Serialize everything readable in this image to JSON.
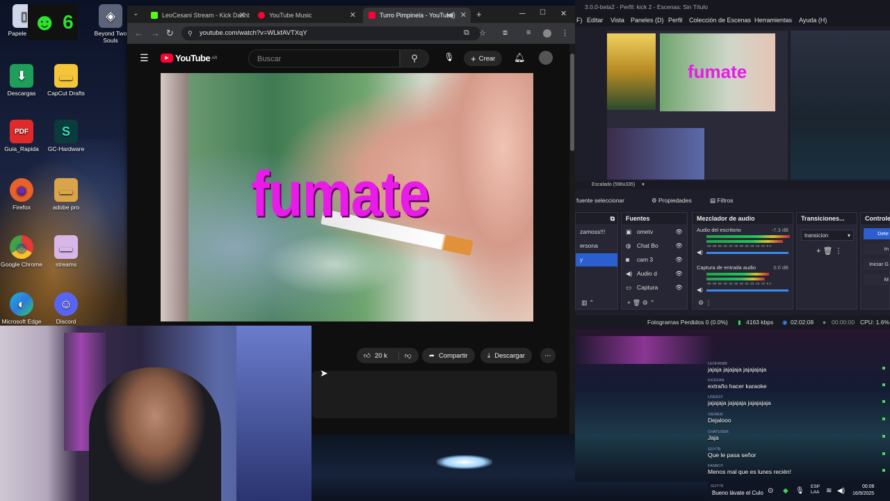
{
  "desktop": {
    "icons": [
      {
        "label": "Papele recic",
        "glyph": "▯"
      },
      {
        "label": "Beyond Two Souls",
        "glyph": "◈"
      },
      {
        "label": "Descargas",
        "glyph": "⬇"
      },
      {
        "label": "CapCut Drafts",
        "glyph": "▬"
      },
      {
        "label": "Guia_Rapida",
        "glyph": "PDF"
      },
      {
        "label": "GC-Hardware",
        "glyph": "S"
      },
      {
        "label": "Firefox",
        "glyph": "◉"
      },
      {
        "label": "adobe pro",
        "glyph": "▬"
      },
      {
        "label": "Google Chrome",
        "glyph": "◎"
      },
      {
        "label": "streams",
        "glyph": "▬"
      },
      {
        "label": "Microsoft Edge",
        "glyph": "◐"
      },
      {
        "label": "Discord",
        "glyph": "☺"
      }
    ],
    "overlay_count": "6"
  },
  "browser": {
    "tabs": [
      {
        "title": "LeoCesani Stream - Kick Dashb",
        "color": "#53fc18"
      },
      {
        "title": "YouTube Music",
        "color": "#ff0033"
      },
      {
        "title": "Turro Pimpinela - YouTube",
        "color": "#ff0033"
      }
    ],
    "url": "youtube.com/watch?v=WLkfAVTXqY",
    "youtube": {
      "logo": "YouTube",
      "region": "AR",
      "search_placeholder": "Buscar",
      "create_label": "Crear",
      "video_caption": "fumate",
      "likes": "20 k",
      "share_label": "Compartir",
      "download_label": "Descargar"
    }
  },
  "obs": {
    "title": "3.0.0-beta2 - Perfil: kick 2 - Escenas: Sin Título",
    "menu": [
      "Editar",
      "Vista",
      "Paneles (D)",
      "Perfil",
      "Colección de Escenas",
      "Herramientas",
      "Ayuda (H)"
    ],
    "scale_label": "Escalado (596x335)",
    "source_name": "fuente seleccionar",
    "properties_label": "Propiedades",
    "filters_label": "Filtros",
    "scenes": [
      "zamoss!!!",
      "ersona",
      "y"
    ],
    "sources_title": "Fuentes",
    "sources": [
      "ometv",
      "Chat Bo",
      "cam 3",
      "Audio d",
      "Captura"
    ],
    "mixer_title": "Mezclador de audio",
    "mixer": [
      {
        "name": "Audio del escritorio",
        "db": "-7.3 dB"
      },
      {
        "name": "Captura de entrada audio",
        "db": "0.0 dB"
      }
    ],
    "meter_scale": "-60 -55 -50 -45 -40 -35 -30 -25 -20 -15 -10 -5 0",
    "transitions_title": "Transiciones...",
    "transition_value": "transicion",
    "controls_title": "Controles",
    "controls": [
      "Dete",
      "In",
      "Iniciar G",
      "M"
    ],
    "status": {
      "dropped": "Fotogramas Perdidos 0 (0.0%)",
      "bitrate": "4163 kbps",
      "stream_time": "02:02:08",
      "rec_time": "00:00:00",
      "cpu": "CPU: 1.6%"
    }
  },
  "chat": [
    {
      "user": "LEOFAN88",
      "text": "jajaja jajajaja jajajajaja"
    },
    {
      "user": "KICKFAN",
      "text": "extraño hacer karaoke"
    },
    {
      "user": "USER22",
      "text": "jajajaja jajajaja jajajajaja"
    },
    {
      "user": "VIEWER",
      "text": "Dejalooo"
    },
    {
      "user": "CHATUSER",
      "text": "Jaja"
    },
    {
      "user": "GUY78",
      "text": "Que le pasa señor"
    },
    {
      "user": "FANBOY",
      "text": "Menos mal que es lunes recién!"
    },
    {
      "user": "GUY78",
      "text": "Bueno lávate el Culo"
    }
  ],
  "taskbar": {
    "lang": "ESP\nLAA",
    "time": "00:06",
    "date": "16/9/2025"
  }
}
